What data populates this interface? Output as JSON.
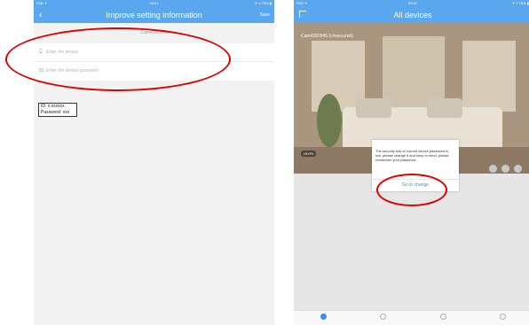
{
  "left_screen": {
    "status_bar": {
      "left": "PAD ✦",
      "center": "09:21",
      "right": "✈ 1 78% ▮"
    },
    "nav": {
      "title": "Improve setting information",
      "save_label": "Save"
    },
    "device_id": "Cam4397845",
    "fields": [
      {
        "icon": "user-icon",
        "placeholder": "Enter the device"
      },
      {
        "icon": "lock-icon",
        "placeholder": "Enter the device password"
      }
    ],
    "note": {
      "line1": "ID: x.xxxxxx",
      "line2": "Password: xxx"
    }
  },
  "right_screen": {
    "status_bar": {
      "left": "PAD ✦",
      "center": "09:21",
      "right": "✈ 1 78% ▮"
    },
    "nav": {
      "title": "All devices"
    },
    "camera": {
      "name": "Cam4397845 (Unsecured)",
      "hd_label": "HD/Fit"
    },
    "dialog": {
      "message": "The security risk of current device password is low, please change it and keep in mind, please remember your password.",
      "button": "Go to change"
    },
    "tabs": [
      "devices-tab",
      "alerts-tab",
      "discover-tab",
      "profile-tab"
    ]
  },
  "colors": {
    "nav": "#5aa7ef",
    "accent": "#3b8fe8",
    "highlight": "#e00000"
  }
}
